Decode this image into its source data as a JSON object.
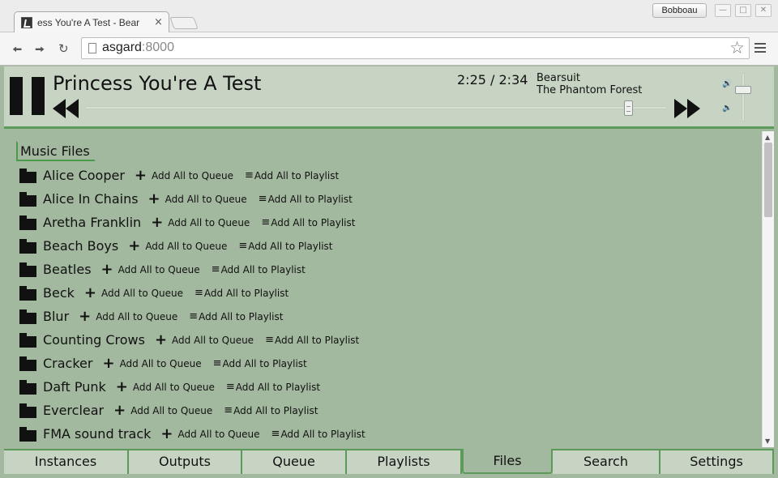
{
  "browser": {
    "tab_title": "ess You're A Test - Bear",
    "tab_close": "×",
    "profile_name": "Bobboau",
    "url_host": "asgard",
    "url_port": ":8000",
    "icons": {
      "favicon": "harp-icon",
      "back": "back-arrow-icon",
      "forward": "forward-arrow-icon",
      "reload": "reload-icon",
      "page": "page-icon",
      "bookmark": "star-icon",
      "menu": "hamburger-menu-icon"
    }
  },
  "player": {
    "title": "Princess You're A Test",
    "time": "2:25 / 2:34",
    "artist": "Bearsuit",
    "album": "The Phantom Forest",
    "progress_fraction": 0.94,
    "volume_fraction": 0.8,
    "icons": {
      "pause": "pause-icon",
      "previous": "previous-track-icon",
      "next": "next-track-icon",
      "volume_up": "volume-up-icon",
      "volume_down": "volume-down-icon"
    }
  },
  "files": {
    "current_path": "Music Files",
    "add_queue_label": "Add All to Queue",
    "add_playlist_label": "Add All to Playlist",
    "folders": [
      "Alice Cooper",
      "Alice In Chains",
      "Aretha Franklin",
      "Beach Boys",
      "Beatles",
      "Beck",
      "Blur",
      "Counting Crows",
      "Cracker",
      "Daft Punk",
      "Everclear",
      "FMA sound track"
    ],
    "icons": {
      "folder": "folder-icon",
      "add": "plus-icon",
      "playlist": "list-icon"
    }
  },
  "tabs": [
    {
      "label": "Instances"
    },
    {
      "label": "Outputs"
    },
    {
      "label": "Queue"
    },
    {
      "label": "Playlists"
    },
    {
      "label": "Files",
      "active": true
    },
    {
      "label": "Search"
    },
    {
      "label": "Settings"
    }
  ],
  "colors": {
    "background": "#a3b99f",
    "header": "#c7d4c4",
    "accent": "#5c9a5a"
  }
}
